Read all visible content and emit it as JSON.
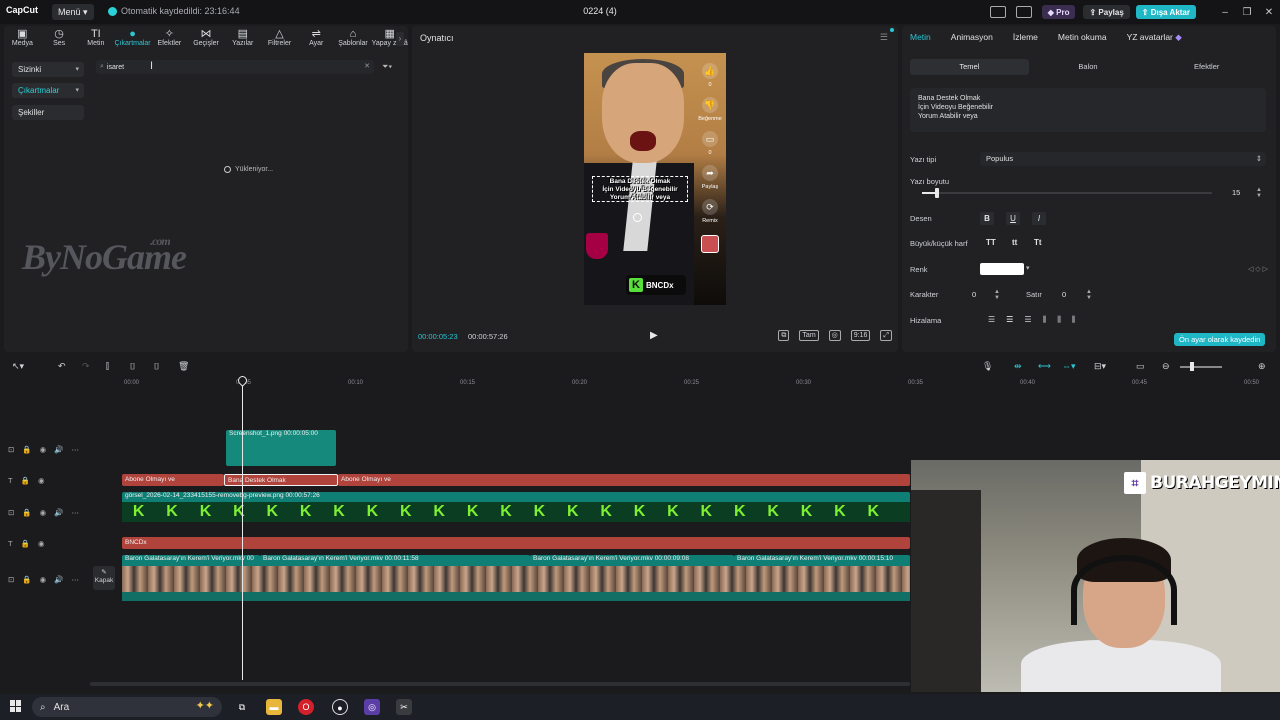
{
  "window": {
    "app_name": "CapCut",
    "menu_label": "Menü",
    "autosave_text": "Otomatik kaydedildi: 23:16:44",
    "project_title": "0224 (4)",
    "pro_label": "Pro",
    "share_label": "Paylaş",
    "export_label": "Dışa Aktar"
  },
  "toolbar": {
    "tools": [
      {
        "label": "Medya",
        "icon": "media-icon"
      },
      {
        "label": "Ses",
        "icon": "audio-icon"
      },
      {
        "label": "Metin",
        "icon": "text-icon"
      },
      {
        "label": "Çıkartmalar",
        "icon": "sticker-icon"
      },
      {
        "label": "Efektler",
        "icon": "effects-icon"
      },
      {
        "label": "Geçişler",
        "icon": "transitions-icon"
      },
      {
        "label": "Yazılar",
        "icon": "captions-icon"
      },
      {
        "label": "Filtreler",
        "icon": "filters-icon"
      },
      {
        "label": "Ayar",
        "icon": "adjust-icon"
      },
      {
        "label": "Şablonlar",
        "icon": "templates-icon"
      },
      {
        "label": "Yapay zekâ",
        "icon": "ai-icon"
      }
    ],
    "active_tool": "Çıkartmalar"
  },
  "left_panel": {
    "categories": [
      "Sizinki",
      "Çıkartmalar",
      "Şekiller"
    ],
    "search_value": "isaret",
    "loading_text": "Yükleniyor...",
    "watermark_text": "ByNoGame",
    "watermark_suffix": ".com"
  },
  "player": {
    "title": "Oynatıcı",
    "current_time": "00:00:05:23",
    "total_time": "00:00:57:26",
    "caption_lines": [
      "Bana Destek Olmak",
      "İçin Videoyu Beğenebilir",
      "Yorum Atabilir veya"
    ],
    "side_labels": [
      "0",
      "Beğenme",
      "0",
      "Paylaş",
      "Remix"
    ],
    "brand_text": "BNCDx",
    "brand_letter": "K",
    "tool_labels": [
      "Tam",
      "9:16"
    ]
  },
  "right_panel": {
    "tabs": [
      "Metin",
      "Animasyon",
      "İzleme",
      "Metin okuma",
      "YZ avatarlar"
    ],
    "active_tab": "Metin",
    "subtabs": [
      "Temel",
      "Balon",
      "Efektler"
    ],
    "active_subtab": "Temel",
    "text_content": [
      "Bana Destek Olmak",
      "İçin Videoyu Beğenebilir",
      "Yorum Atabilir veya"
    ],
    "font_label": "Yazı tipi",
    "font_value": "Populus",
    "size_label": "Yazı boyutu",
    "size_value": "15",
    "size_fraction": 0.05,
    "pattern_label": "Desen",
    "pattern_buttons": [
      "B",
      "U",
      "I"
    ],
    "case_label": "Büyük/küçük harf",
    "case_buttons": [
      "TT",
      "tt",
      "Tt"
    ],
    "color_label": "Renk",
    "color_value": "#ffffff",
    "char_label": "Karakter",
    "char_value": "0",
    "line_label": "Satır",
    "line_value": "0",
    "align_label": "Hizalama",
    "default_button": "Ön ayar olarak kaydedin"
  },
  "timeline": {
    "ruler_labels": [
      "00:00",
      "00:05",
      "00:10",
      "00:15",
      "00:20",
      "00:25",
      "00:30",
      "00:35",
      "00:40",
      "00:45",
      "00:50"
    ],
    "clips": {
      "screenshot_clip": "Screenshot_1.png  00:00:05:00",
      "text_clip_1": "Abone Olmayı ve",
      "text_clip_2": "Bana Destek Olmak",
      "text_clip_3": "Abone Olmayı ve",
      "image_clip": "görsel_2026-02-14_233415155-removebg-preview.png  00:00:57:26",
      "brand_clip": "BNCDx",
      "video_clip_1": "Baron Galatasaray'ın Kerem'i Veriyor.mkv  00",
      "video_clip_2": "Baron Galatasaray'ın Kerem'i Veriyor.mkv  00:00:11:58",
      "video_clip_3": "Baron Galatasaray'ın Kerem'i Veriyor.mkv  00:00:09:08",
      "video_clip_4": "Baron Galatasaray'ın Kerem'i Veriyor.mkv  00:00:15:10"
    },
    "cover_label": "Kapak",
    "k_letter": "K"
  },
  "overlay": {
    "streamer_name": "BURAHGEYMING"
  },
  "taskbar": {
    "search_placeholder": "Ara"
  }
}
